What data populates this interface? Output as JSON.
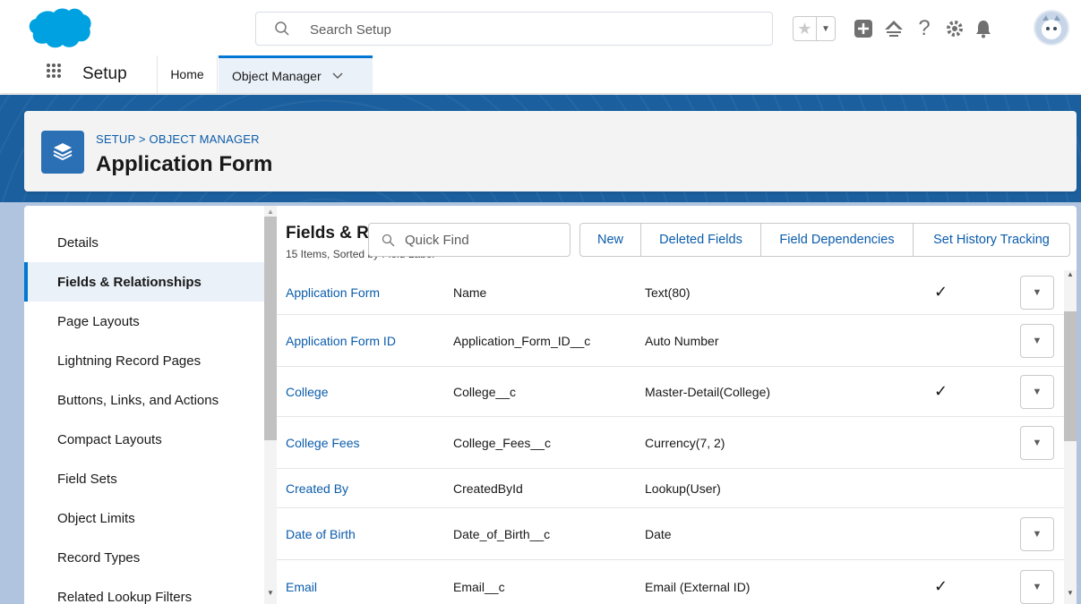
{
  "colors": {
    "brand": "#00a1e0",
    "link": "#0b5cab",
    "accent": "#0176d3"
  },
  "header": {
    "search_placeholder": "Search Setup",
    "icons": [
      "favorite-star-icon",
      "favorites-dropdown-icon",
      "global-actions-icon",
      "trailhead-icon",
      "help-icon",
      "setup-gear-icon",
      "notifications-bell-icon",
      "avatar"
    ]
  },
  "context_bar": {
    "app_name": "Setup",
    "tabs": [
      {
        "label": "Home"
      },
      {
        "label": "Object Manager"
      }
    ]
  },
  "page_header": {
    "breadcrumb": "SETUP > OBJECT MANAGER",
    "title": "Application Form"
  },
  "left_nav": {
    "items": [
      {
        "label": "Details"
      },
      {
        "label": "Fields & Relationships",
        "active": true
      },
      {
        "label": "Page Layouts"
      },
      {
        "label": "Lightning Record Pages"
      },
      {
        "label": "Buttons, Links, and Actions"
      },
      {
        "label": "Compact Layouts"
      },
      {
        "label": "Field Sets"
      },
      {
        "label": "Object Limits"
      },
      {
        "label": "Record Types"
      },
      {
        "label": "Related Lookup Filters"
      }
    ]
  },
  "fields_section": {
    "title": "Fields & R",
    "subtitle": "15 Items, Sorted by Field Label",
    "quick_find_placeholder": "Quick Find",
    "buttons": [
      {
        "label": "New"
      },
      {
        "label": "Deleted Fields"
      },
      {
        "label": "Field Dependencies"
      },
      {
        "label": "Set History Tracking"
      }
    ],
    "rows": [
      {
        "label": "Application Form",
        "api": "Name",
        "type": "Text(80)",
        "indexed": true,
        "menu": true
      },
      {
        "label": "Application Form ID",
        "api": "Application_Form_ID__c",
        "type": "Auto Number",
        "indexed": false,
        "menu": true
      },
      {
        "label": "College",
        "api": "College__c",
        "type": "Master-Detail(College)",
        "indexed": true,
        "menu": true
      },
      {
        "label": "College Fees",
        "api": "College_Fees__c",
        "type": "Currency(7, 2)",
        "indexed": false,
        "menu": true
      },
      {
        "label": "Created By",
        "api": "CreatedById",
        "type": "Lookup(User)",
        "indexed": false,
        "menu": false
      },
      {
        "label": "Date of Birth",
        "api": "Date_of_Birth__c",
        "type": "Date",
        "indexed": false,
        "menu": true
      },
      {
        "label": "Email",
        "api": "Email__c",
        "type": "Email (External ID)",
        "indexed": true,
        "menu": true
      }
    ]
  }
}
